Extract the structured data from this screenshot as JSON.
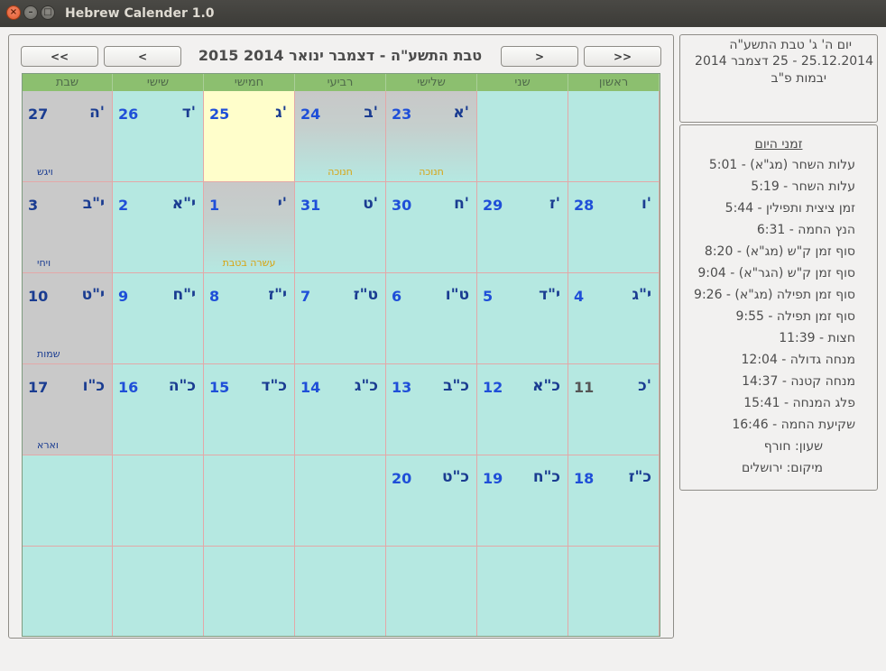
{
  "window": {
    "title": "Hebrew Calender 1.0"
  },
  "nav": {
    "prev_year": "<<",
    "prev_month": "<",
    "next_month": ">",
    "next_year": ">>",
    "title": "טבת התשע\"ה - דצמבר ינואר 2014 2015"
  },
  "weekdays": [
    "ראשון",
    "שני",
    "שלישי",
    "רביעי",
    "חמישי",
    "שישי",
    "שבת"
  ],
  "weeks": [
    [
      {
        "heb": "",
        "greg": ""
      },
      {
        "heb": "",
        "greg": ""
      },
      {
        "heb": "א'",
        "greg": "23",
        "note": "חנוכה"
      },
      {
        "heb": "ב'",
        "greg": "24",
        "note": "חנוכה"
      },
      {
        "heb": "ג'",
        "greg": "25"
      },
      {
        "heb": "ד'",
        "greg": "26"
      },
      {
        "heb": "ה'",
        "greg": "27",
        "parasha": "ויגש"
      }
    ],
    [
      {
        "heb": "ו'",
        "greg": "28"
      },
      {
        "heb": "ז'",
        "greg": "29"
      },
      {
        "heb": "ח'",
        "greg": "30"
      },
      {
        "heb": "ט'",
        "greg": "31"
      },
      {
        "heb": "י'",
        "greg": "1",
        "note": "עשרה בטבת"
      },
      {
        "heb": "י\"א",
        "greg": "2"
      },
      {
        "heb": "י\"ב",
        "greg": "3",
        "parasha": "ויחי"
      }
    ],
    [
      {
        "heb": "י\"ג",
        "greg": "4"
      },
      {
        "heb": "י\"ד",
        "greg": "5"
      },
      {
        "heb": "ט\"ו",
        "greg": "6"
      },
      {
        "heb": "ט\"ז",
        "greg": "7"
      },
      {
        "heb": "י\"ז",
        "greg": "8"
      },
      {
        "heb": "י\"ח",
        "greg": "9"
      },
      {
        "heb": "י\"ט",
        "greg": "10",
        "parasha": "שמות"
      }
    ],
    [
      {
        "heb": "כ'",
        "greg": "11"
      },
      {
        "heb": "כ\"א",
        "greg": "12"
      },
      {
        "heb": "כ\"ב",
        "greg": "13"
      },
      {
        "heb": "כ\"ג",
        "greg": "14"
      },
      {
        "heb": "כ\"ד",
        "greg": "15"
      },
      {
        "heb": "כ\"ה",
        "greg": "16"
      },
      {
        "heb": "כ\"ו",
        "greg": "17",
        "parasha": "וארא"
      }
    ],
    [
      {
        "heb": "כ\"ז",
        "greg": "18"
      },
      {
        "heb": "כ\"ח",
        "greg": "19"
      },
      {
        "heb": "כ\"ט",
        "greg": "20"
      },
      {
        "heb": "",
        "greg": ""
      },
      {
        "heb": "",
        "greg": ""
      },
      {
        "heb": "",
        "greg": ""
      },
      {
        "heb": "",
        "greg": ""
      }
    ],
    [
      {
        "heb": "",
        "greg": ""
      },
      {
        "heb": "",
        "greg": ""
      },
      {
        "heb": "",
        "greg": ""
      },
      {
        "heb": "",
        "greg": ""
      },
      {
        "heb": "",
        "greg": ""
      },
      {
        "heb": "",
        "greg": ""
      },
      {
        "heb": "",
        "greg": ""
      }
    ]
  ],
  "selected_day": {
    "line1": "יום ה' ג' טבת התשע\"ה",
    "line2": "25.12.2014 - 25 דצמבר 2014",
    "line3": "יבמות פ\"ב"
  },
  "zmanim": {
    "header": "זמני היום",
    "items": [
      "עלות השחר (מג\"א) - 5:01",
      "עלות השחר - 5:19",
      "זמן ציצית ותפילין - 5:44",
      "הנץ החמה - 6:31",
      "סוף זמן ק\"ש (מג\"א) - 8:20",
      "סוף זמן ק\"ש (הגר\"א) - 9:04",
      "סוף זמן תפילה (מג\"א) - 9:26",
      "סוף זמן תפילה - 9:55",
      "חצות - 11:39",
      "מנחה גדולה - 12:04",
      "מנחה קטנה - 14:37",
      "פלג המנחה - 15:41",
      "שקיעת החמה - 16:46",
      "שעון: חורף",
      "מיקום: ירושלים"
    ]
  },
  "colors": {
    "cell": "#b5e8e1",
    "header": "#8cbf6f",
    "shabbat": "#c9c9c9",
    "today": "#fffecb",
    "holiday_note": "#d7a40f",
    "parasha_note": "#1a3c91"
  }
}
